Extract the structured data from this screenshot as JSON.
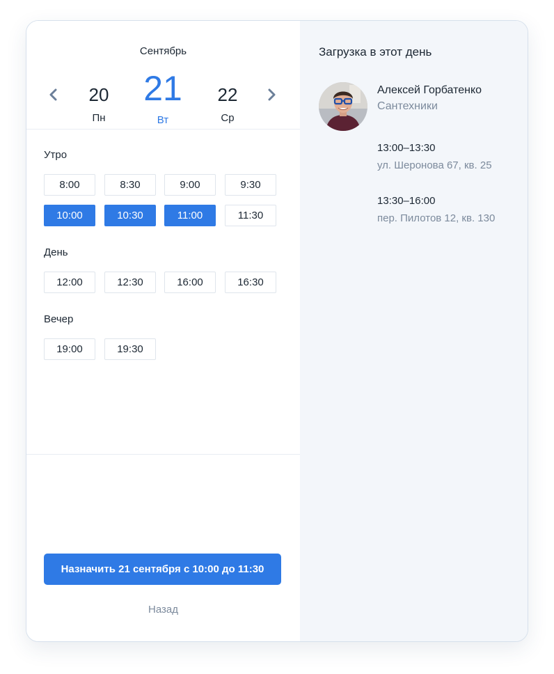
{
  "calendar": {
    "month": "Сентябрь",
    "prev_day": {
      "num": "20",
      "weekday": "Пн"
    },
    "current_day": {
      "num": "21",
      "weekday": "Вт"
    },
    "next_day": {
      "num": "22",
      "weekday": "Ср"
    },
    "prev_icon": "chevron-left-icon",
    "next_icon": "chevron-right-icon"
  },
  "sections": {
    "morning": {
      "title": "Утро",
      "slots": [
        {
          "label": "8:00",
          "selected": false
        },
        {
          "label": "8:30",
          "selected": false
        },
        {
          "label": "9:00",
          "selected": false
        },
        {
          "label": "9:30",
          "selected": false
        },
        {
          "label": "10:00",
          "selected": true
        },
        {
          "label": "10:30",
          "selected": true
        },
        {
          "label": "11:00",
          "selected": true
        },
        {
          "label": "11:30",
          "selected": false
        }
      ]
    },
    "day": {
      "title": "День",
      "slots": [
        {
          "label": "12:00",
          "selected": false
        },
        {
          "label": "12:30",
          "selected": false
        },
        {
          "label": "16:00",
          "selected": false
        },
        {
          "label": "16:30",
          "selected": false
        }
      ]
    },
    "evening": {
      "title": "Вечер",
      "slots": [
        {
          "label": "19:00",
          "selected": false
        },
        {
          "label": "19:30",
          "selected": false
        }
      ]
    }
  },
  "actions": {
    "assign_label": "Назначить 21 сентября с 10:00 до 11:30",
    "back_label": "Назад"
  },
  "load_panel": {
    "title": "Загрузка в этот день",
    "worker": {
      "name": "Алексей Горбатенко",
      "role": "Сантехники"
    },
    "appointments": [
      {
        "time": "13:00–13:30",
        "address": "ул. Шеронова 67, кв. 25"
      },
      {
        "time": "13:30–16:00",
        "address": "пер. Пилотов 12, кв. 130"
      }
    ]
  },
  "colors": {
    "accent": "#2f7ae5",
    "text": "#1c2733",
    "muted": "#7c8a9c",
    "panel_bg": "#f3f6fa"
  }
}
